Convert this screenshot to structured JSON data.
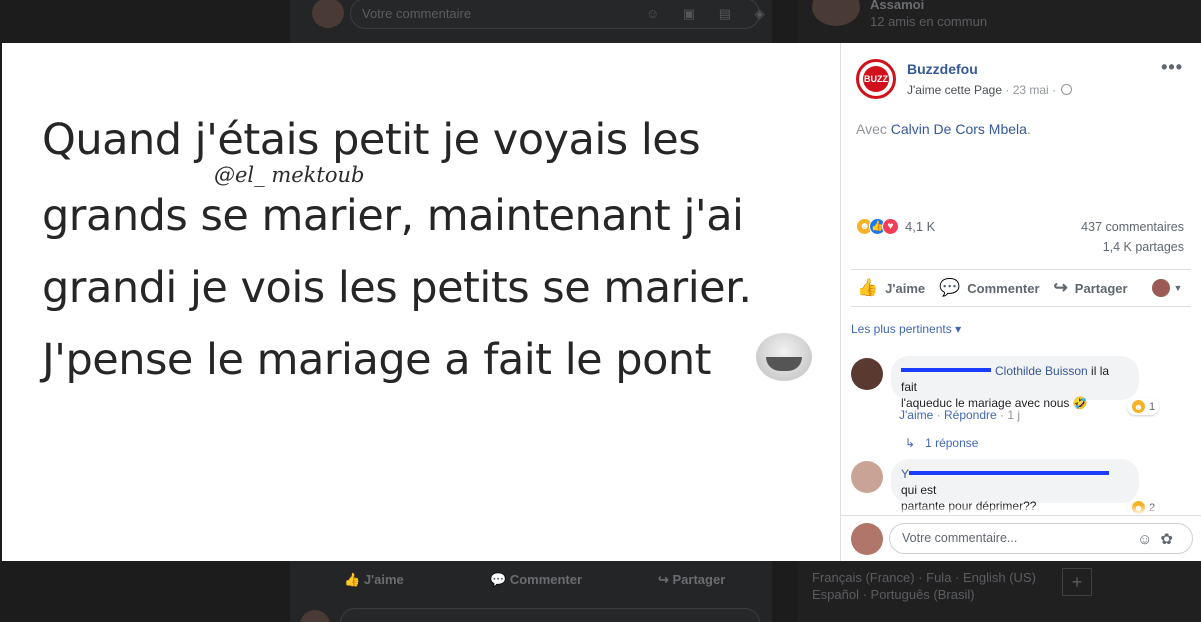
{
  "background": {
    "comment_placeholder": "Votre commentaire",
    "friend_name": "Assamoi",
    "mutual_friends": "12 amis en commun",
    "actions": {
      "like": "J'aime",
      "comment": "Commenter",
      "share": "Partager"
    },
    "languages_line1": "Français (France) · Fula · English (US)",
    "languages_line2": "Español · Português (Brasil)",
    "add_language": "+"
  },
  "photo": {
    "lines": [
      "Quand j'étais petit je voyais les",
      "grands se marier, maintenant j'ai",
      "grandi je vois les petits se marier.",
      "J'pense le mariage a fait le pont"
    ],
    "watermark": "@el_ mektoub",
    "emoji": "crying-laughing-emoji"
  },
  "post": {
    "page_name": "Buzzdefou",
    "page_logo_text": "BUZZ",
    "like_page": "J'aime cette Page",
    "separator": " · ",
    "date": "23 mai",
    "with_prefix": "Avec ",
    "with_person": "Calvin De Cors Mbela",
    "with_suffix": ".",
    "reaction_count": "4,1 K",
    "comments_count": "437 commentaires",
    "shares_count": "1,4 K partages",
    "actions": {
      "like": "J'aime",
      "comment": "Commenter",
      "share": "Partager"
    },
    "filter_label": "Les plus pertinents",
    "comment_placeholder": "Votre commentaire..."
  },
  "comments": [
    {
      "author": "Clothilde Buisson",
      "text_after_author": " il la fait",
      "text_line2": "l'aqueduc le mariage avec nous 🤣",
      "like": "J'aime",
      "reply": "Répondre",
      "time": "1 j",
      "reaction_count": "1",
      "replies": "1 réponse"
    },
    {
      "author_hidden_prefix": "Y",
      "text_after_author": " qui est",
      "text_line2": "partante pour déprimer??",
      "reaction_count": "2"
    }
  ],
  "colors": {
    "link": "#365899",
    "brand_red": "#d0101a",
    "haha": "#f7b125",
    "like": "#1877f2",
    "love": "#f33e58"
  }
}
